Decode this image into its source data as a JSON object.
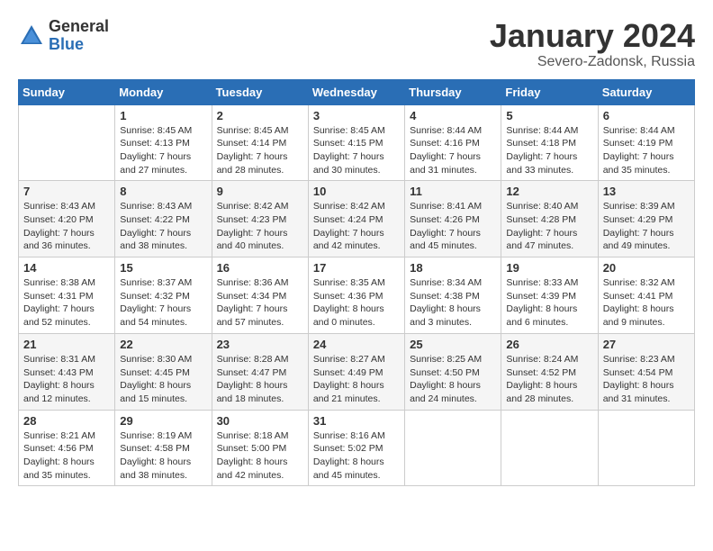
{
  "header": {
    "logo_general": "General",
    "logo_blue": "Blue",
    "month_year": "January 2024",
    "location": "Severo-Zadonsk, Russia"
  },
  "weekdays": [
    "Sunday",
    "Monday",
    "Tuesday",
    "Wednesday",
    "Thursday",
    "Friday",
    "Saturday"
  ],
  "weeks": [
    [
      {
        "day": "",
        "sunrise": "",
        "sunset": "",
        "daylight": ""
      },
      {
        "day": "1",
        "sunrise": "Sunrise: 8:45 AM",
        "sunset": "Sunset: 4:13 PM",
        "daylight": "Daylight: 7 hours and 27 minutes."
      },
      {
        "day": "2",
        "sunrise": "Sunrise: 8:45 AM",
        "sunset": "Sunset: 4:14 PM",
        "daylight": "Daylight: 7 hours and 28 minutes."
      },
      {
        "day": "3",
        "sunrise": "Sunrise: 8:45 AM",
        "sunset": "Sunset: 4:15 PM",
        "daylight": "Daylight: 7 hours and 30 minutes."
      },
      {
        "day": "4",
        "sunrise": "Sunrise: 8:44 AM",
        "sunset": "Sunset: 4:16 PM",
        "daylight": "Daylight: 7 hours and 31 minutes."
      },
      {
        "day": "5",
        "sunrise": "Sunrise: 8:44 AM",
        "sunset": "Sunset: 4:18 PM",
        "daylight": "Daylight: 7 hours and 33 minutes."
      },
      {
        "day": "6",
        "sunrise": "Sunrise: 8:44 AM",
        "sunset": "Sunset: 4:19 PM",
        "daylight": "Daylight: 7 hours and 35 minutes."
      }
    ],
    [
      {
        "day": "7",
        "sunrise": "Sunrise: 8:43 AM",
        "sunset": "Sunset: 4:20 PM",
        "daylight": "Daylight: 7 hours and 36 minutes."
      },
      {
        "day": "8",
        "sunrise": "Sunrise: 8:43 AM",
        "sunset": "Sunset: 4:22 PM",
        "daylight": "Daylight: 7 hours and 38 minutes."
      },
      {
        "day": "9",
        "sunrise": "Sunrise: 8:42 AM",
        "sunset": "Sunset: 4:23 PM",
        "daylight": "Daylight: 7 hours and 40 minutes."
      },
      {
        "day": "10",
        "sunrise": "Sunrise: 8:42 AM",
        "sunset": "Sunset: 4:24 PM",
        "daylight": "Daylight: 7 hours and 42 minutes."
      },
      {
        "day": "11",
        "sunrise": "Sunrise: 8:41 AM",
        "sunset": "Sunset: 4:26 PM",
        "daylight": "Daylight: 7 hours and 45 minutes."
      },
      {
        "day": "12",
        "sunrise": "Sunrise: 8:40 AM",
        "sunset": "Sunset: 4:28 PM",
        "daylight": "Daylight: 7 hours and 47 minutes."
      },
      {
        "day": "13",
        "sunrise": "Sunrise: 8:39 AM",
        "sunset": "Sunset: 4:29 PM",
        "daylight": "Daylight: 7 hours and 49 minutes."
      }
    ],
    [
      {
        "day": "14",
        "sunrise": "Sunrise: 8:38 AM",
        "sunset": "Sunset: 4:31 PM",
        "daylight": "Daylight: 7 hours and 52 minutes."
      },
      {
        "day": "15",
        "sunrise": "Sunrise: 8:37 AM",
        "sunset": "Sunset: 4:32 PM",
        "daylight": "Daylight: 7 hours and 54 minutes."
      },
      {
        "day": "16",
        "sunrise": "Sunrise: 8:36 AM",
        "sunset": "Sunset: 4:34 PM",
        "daylight": "Daylight: 7 hours and 57 minutes."
      },
      {
        "day": "17",
        "sunrise": "Sunrise: 8:35 AM",
        "sunset": "Sunset: 4:36 PM",
        "daylight": "Daylight: 8 hours and 0 minutes."
      },
      {
        "day": "18",
        "sunrise": "Sunrise: 8:34 AM",
        "sunset": "Sunset: 4:38 PM",
        "daylight": "Daylight: 8 hours and 3 minutes."
      },
      {
        "day": "19",
        "sunrise": "Sunrise: 8:33 AM",
        "sunset": "Sunset: 4:39 PM",
        "daylight": "Daylight: 8 hours and 6 minutes."
      },
      {
        "day": "20",
        "sunrise": "Sunrise: 8:32 AM",
        "sunset": "Sunset: 4:41 PM",
        "daylight": "Daylight: 8 hours and 9 minutes."
      }
    ],
    [
      {
        "day": "21",
        "sunrise": "Sunrise: 8:31 AM",
        "sunset": "Sunset: 4:43 PM",
        "daylight": "Daylight: 8 hours and 12 minutes."
      },
      {
        "day": "22",
        "sunrise": "Sunrise: 8:30 AM",
        "sunset": "Sunset: 4:45 PM",
        "daylight": "Daylight: 8 hours and 15 minutes."
      },
      {
        "day": "23",
        "sunrise": "Sunrise: 8:28 AM",
        "sunset": "Sunset: 4:47 PM",
        "daylight": "Daylight: 8 hours and 18 minutes."
      },
      {
        "day": "24",
        "sunrise": "Sunrise: 8:27 AM",
        "sunset": "Sunset: 4:49 PM",
        "daylight": "Daylight: 8 hours and 21 minutes."
      },
      {
        "day": "25",
        "sunrise": "Sunrise: 8:25 AM",
        "sunset": "Sunset: 4:50 PM",
        "daylight": "Daylight: 8 hours and 24 minutes."
      },
      {
        "day": "26",
        "sunrise": "Sunrise: 8:24 AM",
        "sunset": "Sunset: 4:52 PM",
        "daylight": "Daylight: 8 hours and 28 minutes."
      },
      {
        "day": "27",
        "sunrise": "Sunrise: 8:23 AM",
        "sunset": "Sunset: 4:54 PM",
        "daylight": "Daylight: 8 hours and 31 minutes."
      }
    ],
    [
      {
        "day": "28",
        "sunrise": "Sunrise: 8:21 AM",
        "sunset": "Sunset: 4:56 PM",
        "daylight": "Daylight: 8 hours and 35 minutes."
      },
      {
        "day": "29",
        "sunrise": "Sunrise: 8:19 AM",
        "sunset": "Sunset: 4:58 PM",
        "daylight": "Daylight: 8 hours and 38 minutes."
      },
      {
        "day": "30",
        "sunrise": "Sunrise: 8:18 AM",
        "sunset": "Sunset: 5:00 PM",
        "daylight": "Daylight: 8 hours and 42 minutes."
      },
      {
        "day": "31",
        "sunrise": "Sunrise: 8:16 AM",
        "sunset": "Sunset: 5:02 PM",
        "daylight": "Daylight: 8 hours and 45 minutes."
      },
      {
        "day": "",
        "sunrise": "",
        "sunset": "",
        "daylight": ""
      },
      {
        "day": "",
        "sunrise": "",
        "sunset": "",
        "daylight": ""
      },
      {
        "day": "",
        "sunrise": "",
        "sunset": "",
        "daylight": ""
      }
    ]
  ]
}
